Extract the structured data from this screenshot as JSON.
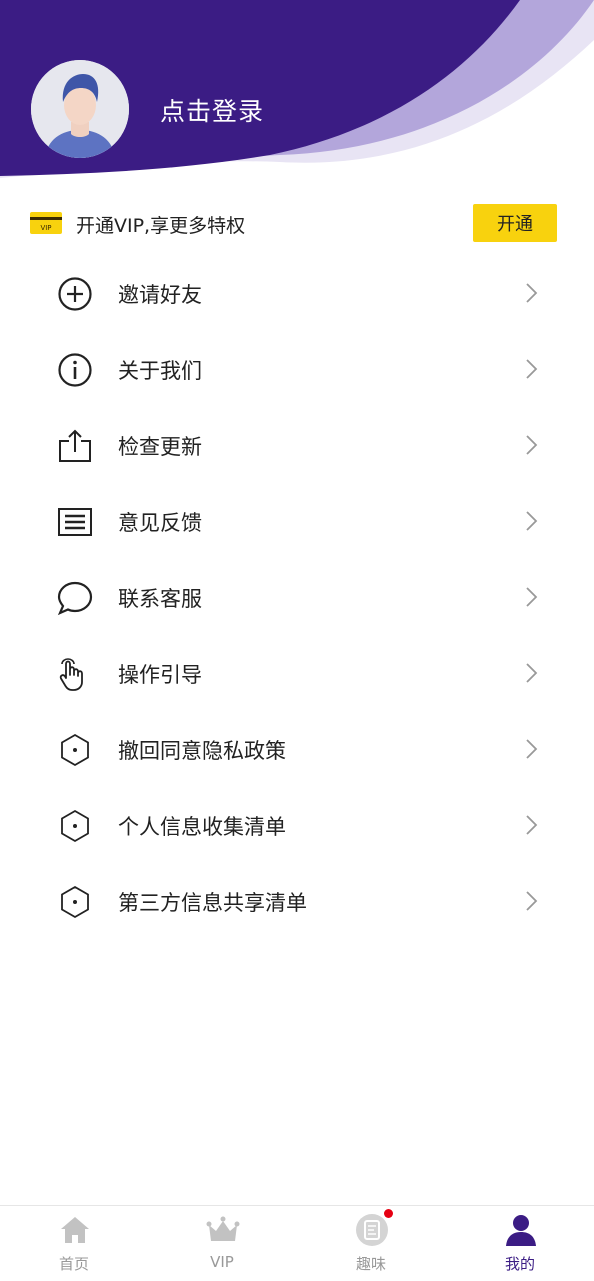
{
  "header": {
    "login_text": "点击登录",
    "colors": {
      "primary": "#3b1c84",
      "accent_light": "#b3a6db",
      "accent_lighter": "#e8e4f4"
    },
    "avatar_icon": "default-user-avatar"
  },
  "vip": {
    "icon": "vip-card-icon",
    "text": "开通VIP,享更多特权",
    "button_label": "开通",
    "button_color": "#f8d20e"
  },
  "menu": {
    "items": [
      {
        "label": "邀请好友",
        "icon": "plus-circle-icon"
      },
      {
        "label": "关于我们",
        "icon": "info-circle-icon"
      },
      {
        "label": "检查更新",
        "icon": "share-upload-icon"
      },
      {
        "label": "意见反馈",
        "icon": "list-icon"
      },
      {
        "label": "联系客服",
        "icon": "chat-bubble-icon"
      },
      {
        "label": "操作引导",
        "icon": "hand-pointer-icon"
      },
      {
        "label": "撤回同意隐私政策",
        "icon": "hexagon-icon"
      },
      {
        "label": "个人信息收集清单",
        "icon": "hexagon-icon"
      },
      {
        "label": "第三方信息共享清单",
        "icon": "hexagon-icon"
      }
    ]
  },
  "tabbar": {
    "tabs": [
      {
        "label": "首页",
        "icon": "home-icon"
      },
      {
        "label": "VIP",
        "icon": "crown-icon"
      },
      {
        "label": "趣味",
        "icon": "fun-doc-icon",
        "badge": true
      },
      {
        "label": "我的",
        "icon": "person-icon",
        "active": true
      }
    ],
    "active_color": "#3b1c84",
    "inactive_color": "#999999"
  }
}
